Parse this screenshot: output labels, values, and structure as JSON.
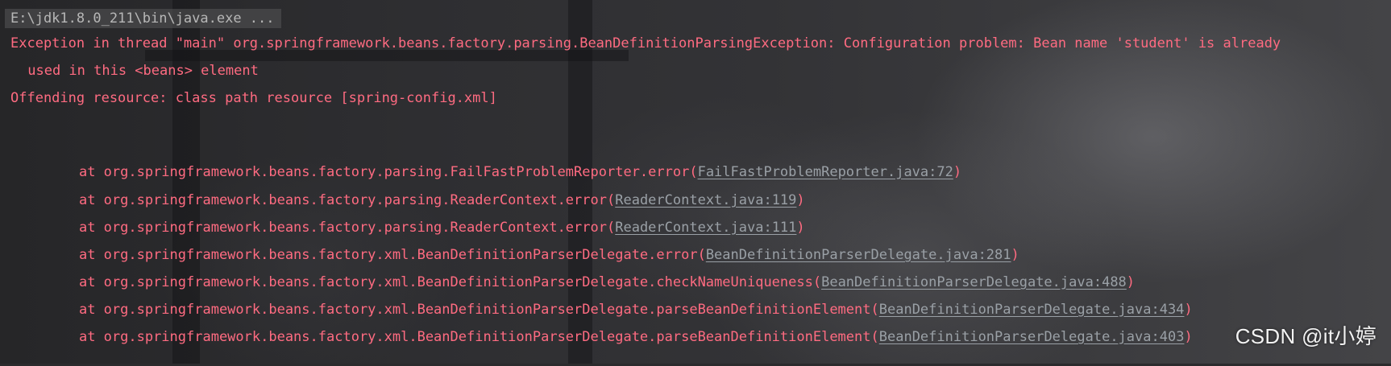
{
  "console": {
    "command": "E:\\jdk1.8.0_211\\bin\\java.exe ...",
    "exception_line": "Exception in thread \"main\" org.springframework.beans.factory.parsing.BeanDefinitionParsingException: Configuration problem: Bean name 'student' is already",
    "exception_continuation": " used in this <beans> element",
    "offending_resource": "Offending resource: class path resource [spring-config.xml]",
    "stack_trace": [
      {
        "prefix": "at org.springframework.beans.factory.parsing.FailFastProblemReporter.error(",
        "link": "FailFastProblemReporter.java:72",
        "suffix": ")"
      },
      {
        "prefix": "at org.springframework.beans.factory.parsing.ReaderContext.error(",
        "link": "ReaderContext.java:119",
        "suffix": ")"
      },
      {
        "prefix": "at org.springframework.beans.factory.parsing.ReaderContext.error(",
        "link": "ReaderContext.java:111",
        "suffix": ")"
      },
      {
        "prefix": "at org.springframework.beans.factory.xml.BeanDefinitionParserDelegate.error(",
        "link": "BeanDefinitionParserDelegate.java:281",
        "suffix": ")"
      },
      {
        "prefix": "at org.springframework.beans.factory.xml.BeanDefinitionParserDelegate.checkNameUniqueness(",
        "link": "BeanDefinitionParserDelegate.java:488",
        "suffix": ")"
      },
      {
        "prefix": "at org.springframework.beans.factory.xml.BeanDefinitionParserDelegate.parseBeanDefinitionElement(",
        "link": "BeanDefinitionParserDelegate.java:434",
        "suffix": ")"
      },
      {
        "prefix": "at org.springframework.beans.factory.xml.BeanDefinitionParserDelegate.parseBeanDefinitionElement(",
        "link": "BeanDefinitionParserDelegate.java:403",
        "suffix": ")"
      }
    ]
  },
  "watermark": "CSDN @it小婷",
  "colors": {
    "error_text": "#ff6b81",
    "link_text": "#9aa0a6",
    "command_text": "#b7b7b7",
    "background": "#2b2b2d"
  }
}
